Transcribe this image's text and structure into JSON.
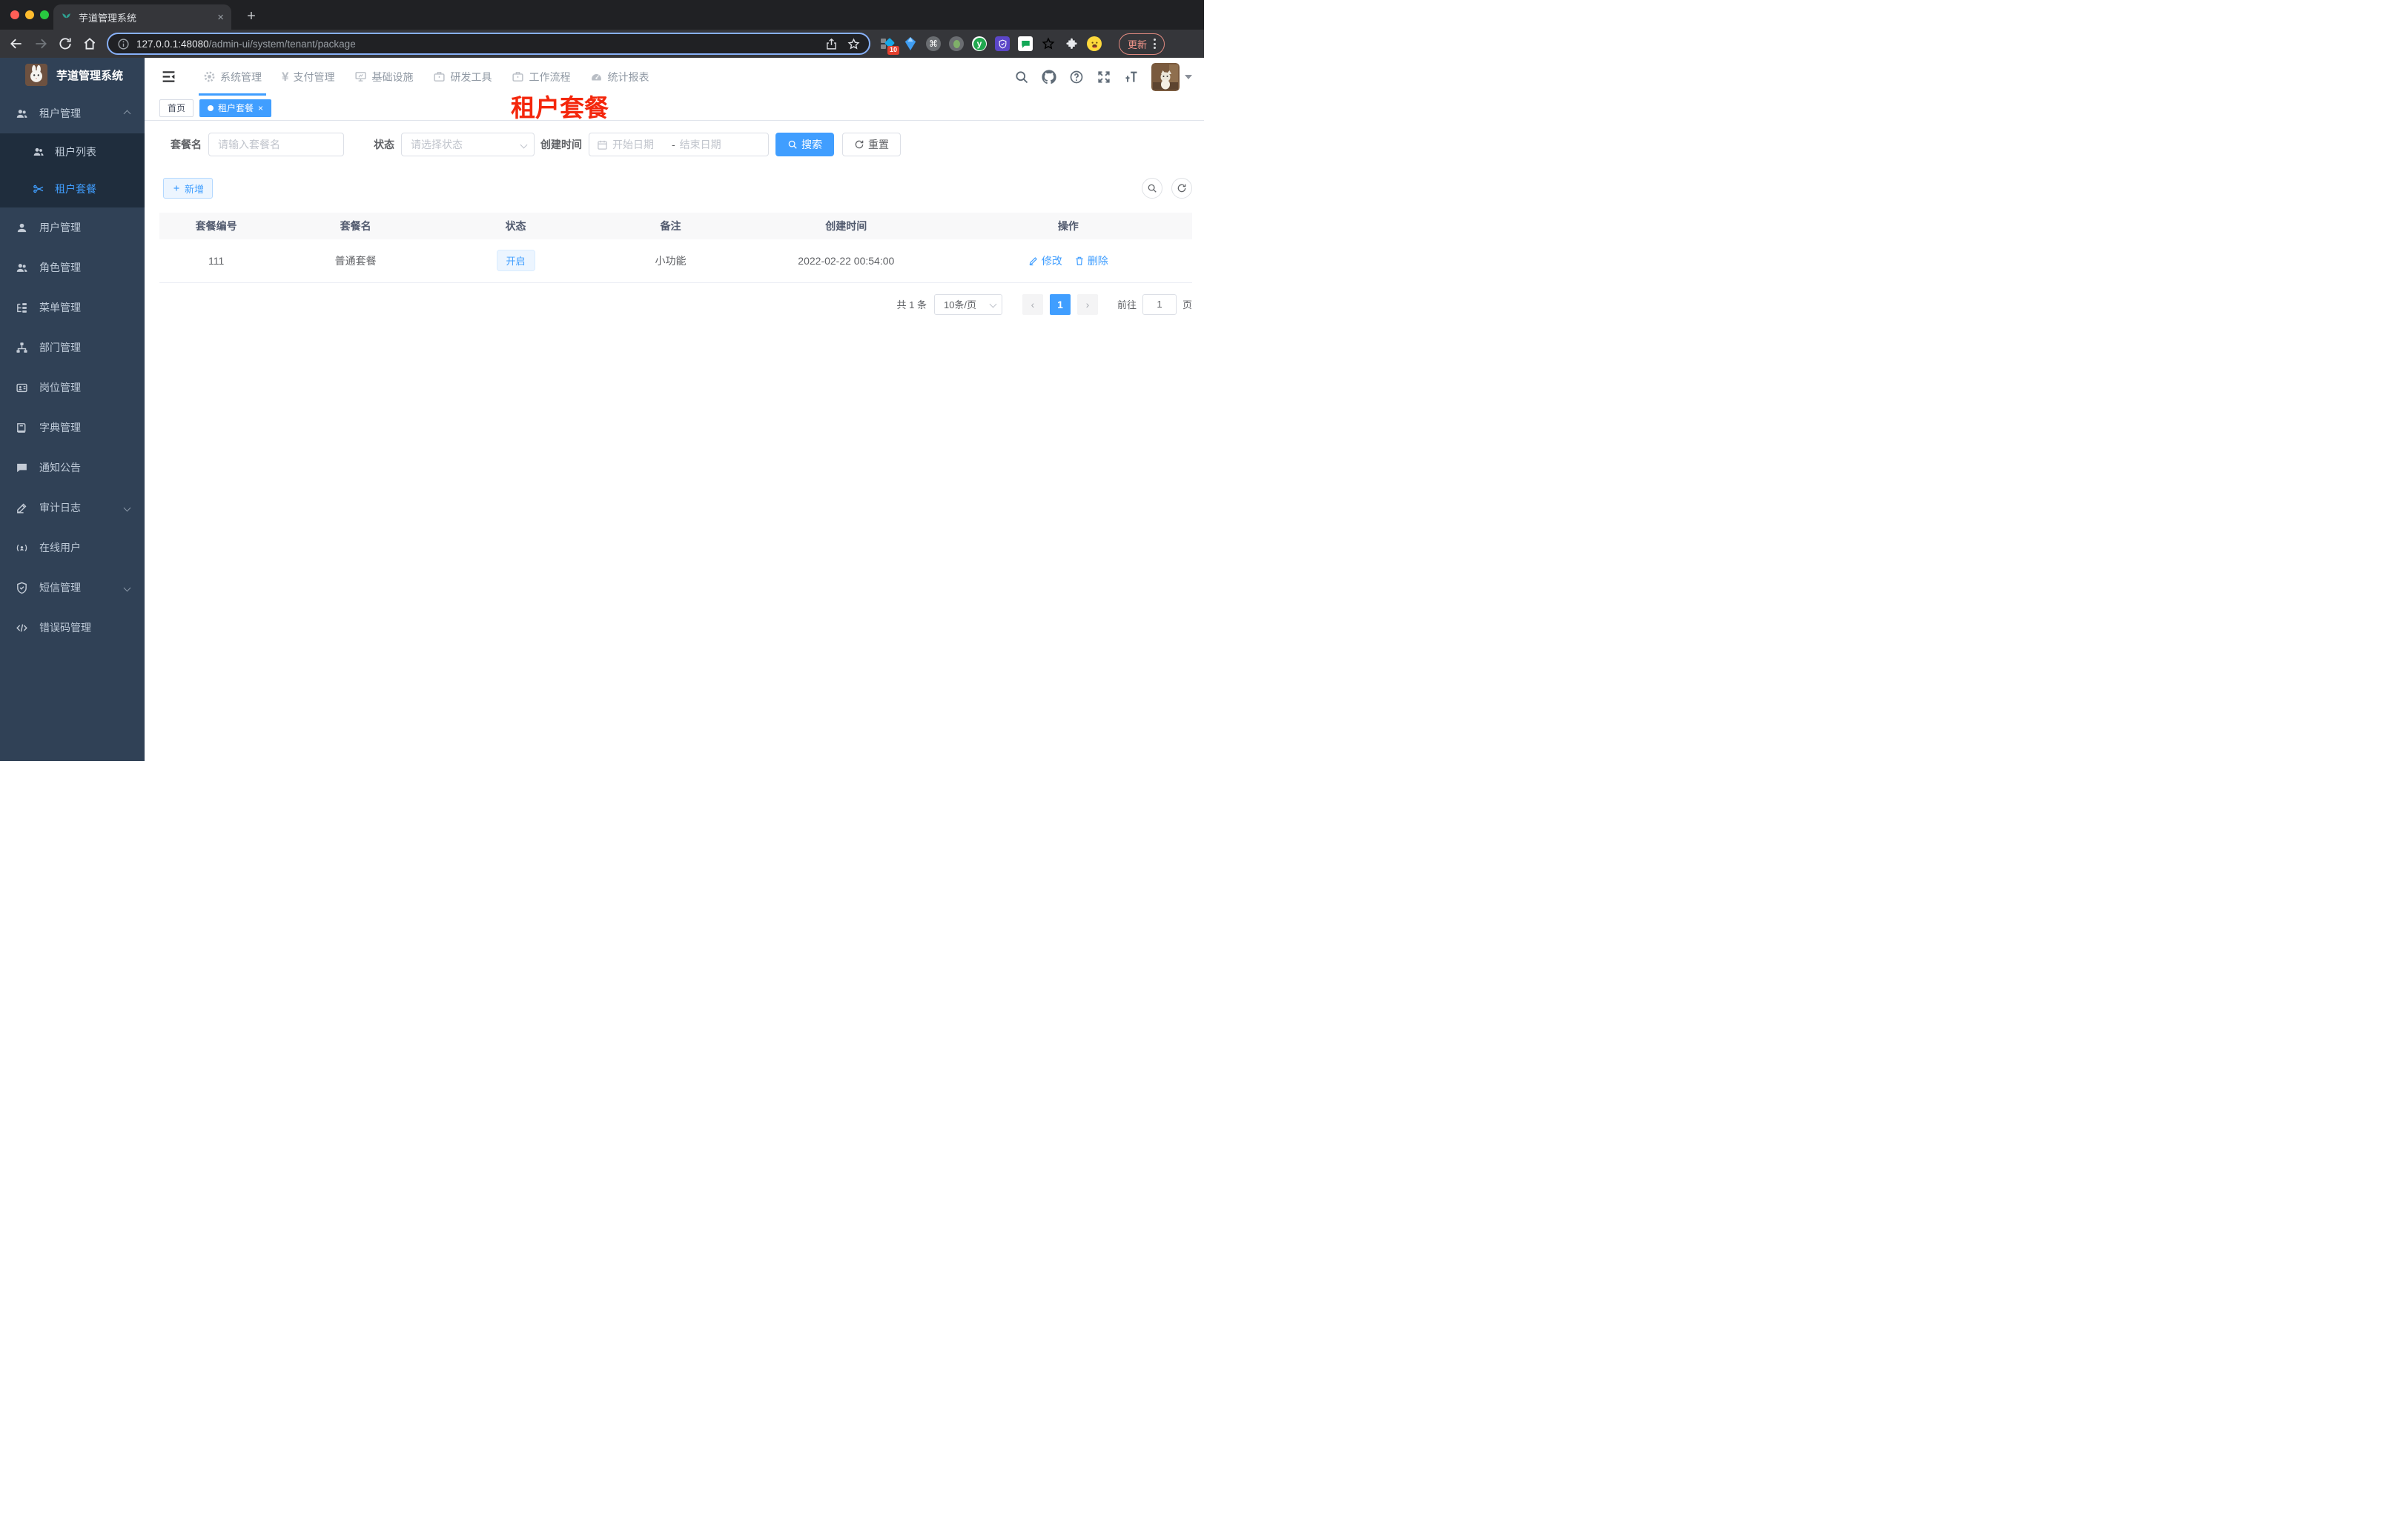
{
  "browser": {
    "tab_title": "芋道管理系统",
    "url_host": "127.0.0.1:48080",
    "url_path": "/admin-ui/system/tenant/package",
    "ext_badge": "10",
    "ext_y_label": "y",
    "update_label": "更新"
  },
  "glyphs": {
    "close": "×",
    "plus": "+",
    "cmd": "⌘",
    "prev": "‹",
    "next": "›"
  },
  "sidebar": {
    "logo_title": "芋道管理系统",
    "items": [
      {
        "label": "租户管理"
      },
      {
        "label": "租户列表"
      },
      {
        "label": "租户套餐"
      },
      {
        "label": "用户管理"
      },
      {
        "label": "角色管理"
      },
      {
        "label": "菜单管理"
      },
      {
        "label": "部门管理"
      },
      {
        "label": "岗位管理"
      },
      {
        "label": "字典管理"
      },
      {
        "label": "通知公告"
      },
      {
        "label": "审计日志"
      },
      {
        "label": "在线用户"
      },
      {
        "label": "短信管理"
      },
      {
        "label": "错误码管理"
      }
    ]
  },
  "topnav": {
    "items": [
      {
        "label": "系统管理"
      },
      {
        "label": "支付管理"
      },
      {
        "label": "基础设施"
      },
      {
        "label": "研发工具"
      },
      {
        "label": "工作流程"
      },
      {
        "label": "统计报表"
      }
    ]
  },
  "tags": {
    "home": "首页",
    "active": "租户套餐"
  },
  "annotation": {
    "text": "租户套餐"
  },
  "filters": {
    "name_label": "套餐名",
    "name_placeholder": "请输入套餐名",
    "status_label": "状态",
    "status_placeholder": "请选择状态",
    "date_label": "创建时间",
    "date_start_placeholder": "开始日期",
    "date_separator": "-",
    "date_end_placeholder": "结束日期",
    "search_label": "搜索",
    "reset_label": "重置"
  },
  "toolbar": {
    "add_label": "新增"
  },
  "table": {
    "headers": [
      "套餐编号",
      "套餐名",
      "状态",
      "备注",
      "创建时间",
      "操作"
    ],
    "rows": [
      {
        "id": "111",
        "name": "普通套餐",
        "status": "开启",
        "remark": "小功能",
        "created": "2022-02-22 00:54:00",
        "edit": "修改",
        "delete": "删除"
      }
    ]
  },
  "pagination": {
    "total": "共 1 条",
    "page_size": "10条/页",
    "page": "1",
    "goto_label": "前往",
    "goto_value": "1",
    "unit": "页"
  },
  "colors": {
    "primary": "#409eff",
    "sidebar_bg": "#304156",
    "submenu_bg": "#1f2d3d",
    "sidebar_text": "#bfcbd9",
    "annotation_red": "#f4270c",
    "table_header_bg": "#f8f8f9",
    "tag_bg": "#ecf5ff"
  }
}
